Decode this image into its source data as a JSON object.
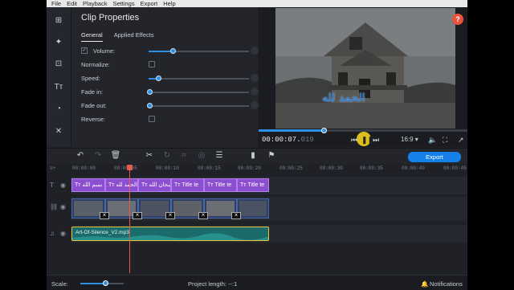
{
  "menu": [
    "File",
    "Edit",
    "Playback",
    "Settings",
    "Export",
    "Help"
  ],
  "clip_properties": {
    "title": "Clip Properties",
    "tabs": [
      "General",
      "Applied Effects"
    ],
    "rows": [
      {
        "label": "Volume:",
        "kind": "slider",
        "checked": true,
        "level": 0.25
      },
      {
        "label": "Normalize:",
        "kind": "checkbox",
        "checked": false
      },
      {
        "label": "Speed:",
        "kind": "slider",
        "level": 0.1
      },
      {
        "label": "Fade in:",
        "kind": "slider",
        "level": 0.0
      },
      {
        "label": "Fade out:",
        "kind": "slider",
        "level": 0.0
      },
      {
        "label": "Reverse:",
        "kind": "checkbox",
        "checked": false
      }
    ]
  },
  "preview": {
    "timecode_main": "00:00:07.",
    "timecode_frac": "019",
    "aspect": "16:9",
    "overlay_text": "الحمد لله",
    "progress": 0.31,
    "help_label": "?"
  },
  "toolbar": {
    "export_label": "Export"
  },
  "ruler_ticks": [
    "00:00:00",
    "00:00:05",
    "00:00:10",
    "00:00:15",
    "00:00:20",
    "00:00:25",
    "00:00:30",
    "00:00:35",
    "00:00:40",
    "00:00:45"
  ],
  "title_clips": [
    {
      "label": "Tт بسم الله"
    },
    {
      "label": "Tт الحمد لله"
    },
    {
      "label": "Tт سبحان الله"
    },
    {
      "label": "Tт Title te"
    },
    {
      "label": "Tт Title te"
    },
    {
      "label": "Tт Title te"
    }
  ],
  "audio_clip": {
    "label": "Art-Of-Silence_V2.mp3"
  },
  "status": {
    "scale_label": "Scale:",
    "project_length": "Project length:  --:1",
    "notifications": "Notifications"
  },
  "colors": {
    "accent": "#1580e8",
    "title_clip": "#8b4fd0",
    "audio_clip": "#1a6b6a",
    "playhead": "#e55a4a"
  }
}
